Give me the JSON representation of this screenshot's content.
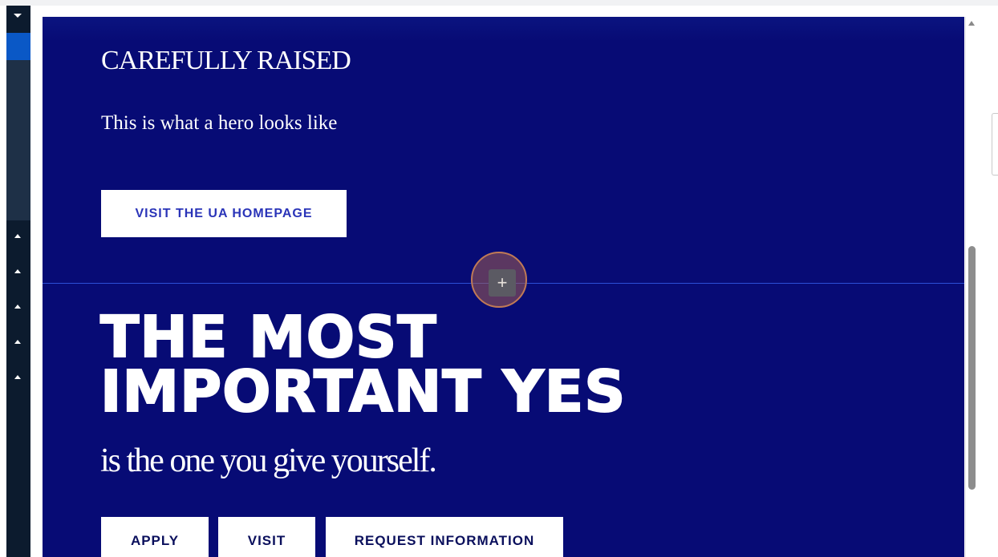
{
  "hero": {
    "eyebrow": "CAREFULLY RAISED",
    "subtitle": "This is what a hero looks like",
    "button_label": "VISIT THE UA HOMEPAGE"
  },
  "section": {
    "headline_line1": "THE MOST",
    "headline_line2": "IMPORTANT YES",
    "tagline": "is the one you give yourself.",
    "buttons": [
      {
        "label": "APPLY"
      },
      {
        "label": "VISIT"
      },
      {
        "label": "REQUEST INFORMATION"
      }
    ]
  },
  "add_block": {
    "icon": "plus-icon",
    "glyph": "+"
  },
  "sidebar": {
    "top_icon": "caret-down-icon",
    "collapse_icons": [
      "caret-up-icon",
      "caret-up-icon",
      "caret-up-icon",
      "caret-up-icon",
      "caret-up-icon"
    ]
  },
  "colors": {
    "canvas_bg": "#070b75",
    "hero_button_text": "#2a34b8",
    "cta_text": "#0a0f5c",
    "divider": "#2b4fd6",
    "sidebar_bg": "#0c1b2e",
    "sidebar_selected": "#0a58c6",
    "add_block_ring": "#c07a56"
  }
}
